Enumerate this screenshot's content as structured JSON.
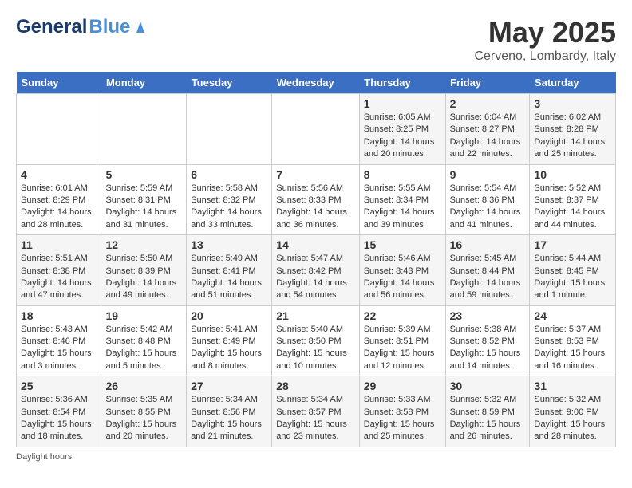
{
  "header": {
    "logo_general": "General",
    "logo_blue": "Blue",
    "month_year": "May 2025",
    "location": "Cerveno, Lombardy, Italy"
  },
  "days_of_week": [
    "Sunday",
    "Monday",
    "Tuesday",
    "Wednesday",
    "Thursday",
    "Friday",
    "Saturday"
  ],
  "weeks": [
    [
      {
        "day": "",
        "info": ""
      },
      {
        "day": "",
        "info": ""
      },
      {
        "day": "",
        "info": ""
      },
      {
        "day": "",
        "info": ""
      },
      {
        "day": "1",
        "info": "Sunrise: 6:05 AM\nSunset: 8:25 PM\nDaylight: 14 hours\nand 20 minutes."
      },
      {
        "day": "2",
        "info": "Sunrise: 6:04 AM\nSunset: 8:27 PM\nDaylight: 14 hours\nand 22 minutes."
      },
      {
        "day": "3",
        "info": "Sunrise: 6:02 AM\nSunset: 8:28 PM\nDaylight: 14 hours\nand 25 minutes."
      }
    ],
    [
      {
        "day": "4",
        "info": "Sunrise: 6:01 AM\nSunset: 8:29 PM\nDaylight: 14 hours\nand 28 minutes."
      },
      {
        "day": "5",
        "info": "Sunrise: 5:59 AM\nSunset: 8:31 PM\nDaylight: 14 hours\nand 31 minutes."
      },
      {
        "day": "6",
        "info": "Sunrise: 5:58 AM\nSunset: 8:32 PM\nDaylight: 14 hours\nand 33 minutes."
      },
      {
        "day": "7",
        "info": "Sunrise: 5:56 AM\nSunset: 8:33 PM\nDaylight: 14 hours\nand 36 minutes."
      },
      {
        "day": "8",
        "info": "Sunrise: 5:55 AM\nSunset: 8:34 PM\nDaylight: 14 hours\nand 39 minutes."
      },
      {
        "day": "9",
        "info": "Sunrise: 5:54 AM\nSunset: 8:36 PM\nDaylight: 14 hours\nand 41 minutes."
      },
      {
        "day": "10",
        "info": "Sunrise: 5:52 AM\nSunset: 8:37 PM\nDaylight: 14 hours\nand 44 minutes."
      }
    ],
    [
      {
        "day": "11",
        "info": "Sunrise: 5:51 AM\nSunset: 8:38 PM\nDaylight: 14 hours\nand 47 minutes."
      },
      {
        "day": "12",
        "info": "Sunrise: 5:50 AM\nSunset: 8:39 PM\nDaylight: 14 hours\nand 49 minutes."
      },
      {
        "day": "13",
        "info": "Sunrise: 5:49 AM\nSunset: 8:41 PM\nDaylight: 14 hours\nand 51 minutes."
      },
      {
        "day": "14",
        "info": "Sunrise: 5:47 AM\nSunset: 8:42 PM\nDaylight: 14 hours\nand 54 minutes."
      },
      {
        "day": "15",
        "info": "Sunrise: 5:46 AM\nSunset: 8:43 PM\nDaylight: 14 hours\nand 56 minutes."
      },
      {
        "day": "16",
        "info": "Sunrise: 5:45 AM\nSunset: 8:44 PM\nDaylight: 14 hours\nand 59 minutes."
      },
      {
        "day": "17",
        "info": "Sunrise: 5:44 AM\nSunset: 8:45 PM\nDaylight: 15 hours\nand 1 minute."
      }
    ],
    [
      {
        "day": "18",
        "info": "Sunrise: 5:43 AM\nSunset: 8:46 PM\nDaylight: 15 hours\nand 3 minutes."
      },
      {
        "day": "19",
        "info": "Sunrise: 5:42 AM\nSunset: 8:48 PM\nDaylight: 15 hours\nand 5 minutes."
      },
      {
        "day": "20",
        "info": "Sunrise: 5:41 AM\nSunset: 8:49 PM\nDaylight: 15 hours\nand 8 minutes."
      },
      {
        "day": "21",
        "info": "Sunrise: 5:40 AM\nSunset: 8:50 PM\nDaylight: 15 hours\nand 10 minutes."
      },
      {
        "day": "22",
        "info": "Sunrise: 5:39 AM\nSunset: 8:51 PM\nDaylight: 15 hours\nand 12 minutes."
      },
      {
        "day": "23",
        "info": "Sunrise: 5:38 AM\nSunset: 8:52 PM\nDaylight: 15 hours\nand 14 minutes."
      },
      {
        "day": "24",
        "info": "Sunrise: 5:37 AM\nSunset: 8:53 PM\nDaylight: 15 hours\nand 16 minutes."
      }
    ],
    [
      {
        "day": "25",
        "info": "Sunrise: 5:36 AM\nSunset: 8:54 PM\nDaylight: 15 hours\nand 18 minutes."
      },
      {
        "day": "26",
        "info": "Sunrise: 5:35 AM\nSunset: 8:55 PM\nDaylight: 15 hours\nand 20 minutes."
      },
      {
        "day": "27",
        "info": "Sunrise: 5:34 AM\nSunset: 8:56 PM\nDaylight: 15 hours\nand 21 minutes."
      },
      {
        "day": "28",
        "info": "Sunrise: 5:34 AM\nSunset: 8:57 PM\nDaylight: 15 hours\nand 23 minutes."
      },
      {
        "day": "29",
        "info": "Sunrise: 5:33 AM\nSunset: 8:58 PM\nDaylight: 15 hours\nand 25 minutes."
      },
      {
        "day": "30",
        "info": "Sunrise: 5:32 AM\nSunset: 8:59 PM\nDaylight: 15 hours\nand 26 minutes."
      },
      {
        "day": "31",
        "info": "Sunrise: 5:32 AM\nSunset: 9:00 PM\nDaylight: 15 hours\nand 28 minutes."
      }
    ]
  ],
  "footer": {
    "daylight_hours_label": "Daylight hours"
  }
}
